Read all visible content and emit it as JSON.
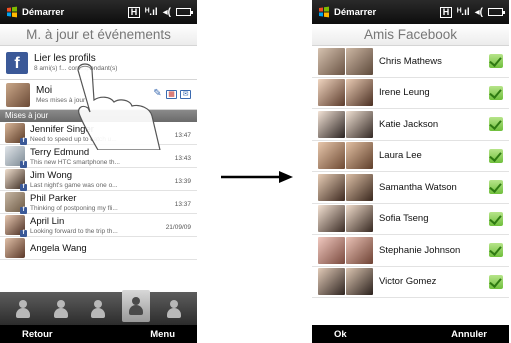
{
  "left_screen": {
    "status": {
      "start_label": "Démarrer"
    },
    "title": "M. à jour et événements",
    "profile_row": {
      "title": "Lier les profils",
      "subtitle": "8 ami(s) f... correspondant(s)"
    },
    "moi_row": {
      "title": "Moi",
      "subtitle": "Mes mises à jour"
    },
    "section_header": "Mises à jour",
    "updates": [
      {
        "name": "Jennifer Singer",
        "message": "Need to speed up to catch u...",
        "time": "13:47"
      },
      {
        "name": "Terry Edmund",
        "message": "This new HTC smartphone th...",
        "time": "13:43"
      },
      {
        "name": "Jim Wong",
        "message": "Last night's game was one o...",
        "time": "13:39"
      },
      {
        "name": "Phil Parker",
        "message": "Thinking of postponing my fli...",
        "time": "13:37"
      },
      {
        "name": "April Lin",
        "message": "Looking forward to the trip th...",
        "time": "21/09/09"
      },
      {
        "name": "Angela Wang",
        "message": "",
        "time": ""
      }
    ],
    "softkeys": {
      "left": "Retour",
      "right": "Menu"
    }
  },
  "right_screen": {
    "status": {
      "start_label": "Démarrer"
    },
    "title": "Amis Facebook",
    "friends": [
      {
        "name": "Chris Mathews",
        "checked": true
      },
      {
        "name": "Irene Leung",
        "checked": true
      },
      {
        "name": "Katie Jackson",
        "checked": true
      },
      {
        "name": "Laura Lee",
        "checked": true
      },
      {
        "name": "Samantha Watson",
        "checked": true
      },
      {
        "name": "Sofia Tseng",
        "checked": true
      },
      {
        "name": "Stephanie Johnson",
        "checked": true
      },
      {
        "name": "Victor Gomez",
        "checked": true
      }
    ],
    "softkeys": {
      "left": "Ok",
      "right": "Annuler"
    }
  },
  "colors": {
    "facebook_blue": "#3b5998",
    "check_green": "#6fbf3c",
    "section_gray": "#7a7a7a",
    "softkey_black": "#000000"
  }
}
